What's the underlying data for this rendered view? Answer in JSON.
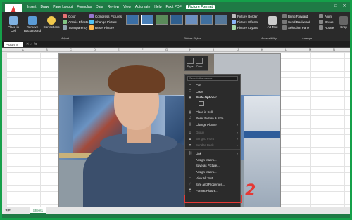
{
  "tabs": [
    "Insert",
    "Draw",
    "Page Layout",
    "Formulas",
    "Data",
    "Review",
    "View",
    "Automate",
    "Help",
    "Foxit PDF",
    "Picture Format"
  ],
  "active_tab": "Picture Format",
  "ribbon": {
    "place_in_cell": "Place in Cell",
    "remove_background": "Remove Background",
    "corrections": "Corrections",
    "color": "Color",
    "artistic_effects": "Artistic Effects",
    "transparency": "Transparency",
    "compress_pictures": "Compress Pictures",
    "change_picture": "Change Picture",
    "reset_picture": "Reset Picture",
    "adjust_label": "Adjust",
    "picture_styles_label": "Picture Styles",
    "picture_border": "Picture Border",
    "picture_effects": "Picture Effects",
    "picture_layout": "Picture Layout",
    "alt_text": "Alt Text",
    "accessibility_label": "Accessibility",
    "bring_forward": "Bring Forward",
    "send_backward": "Send Backward",
    "selection_pane": "Selection Pane",
    "arrange_label": "Arrange",
    "align": "Align",
    "group": "Group",
    "rotate": "Rotate",
    "crop": "Crop"
  },
  "name_box": "Picture 8",
  "columns": [
    "A",
    "B",
    "C",
    "D",
    "E",
    "F",
    "G",
    "H",
    "I",
    "J",
    "K",
    "L",
    "M",
    "N"
  ],
  "mini_toolbar": {
    "style": "Style",
    "crop": "Crop"
  },
  "context_menu": {
    "search_placeholder": "Search the menus",
    "items": [
      {
        "label": "Cut",
        "icon": "scissors-icon",
        "disabled": false,
        "submenu": false
      },
      {
        "label": "Copy",
        "icon": "copy-icon",
        "disabled": false,
        "submenu": false
      },
      {
        "label": "Paste Options:",
        "icon": "paste-icon",
        "disabled": false,
        "submenu": false,
        "bold": true
      },
      {
        "label": "",
        "icon": "",
        "disabled": false,
        "submenu": false,
        "paste_box": true
      },
      {
        "label": "Place in Cell",
        "icon": "place-in-cell-icon",
        "disabled": false,
        "submenu": false
      },
      {
        "label": "Reset Picture & Size",
        "icon": "reset-icon",
        "disabled": false,
        "submenu": false
      },
      {
        "label": "Change Picture",
        "icon": "change-picture-icon",
        "disabled": false,
        "submenu": true
      },
      {
        "label": "Group",
        "icon": "group-icon",
        "disabled": true,
        "submenu": true
      },
      {
        "label": "Bring to Front",
        "icon": "bring-front-icon",
        "disabled": true,
        "submenu": true
      },
      {
        "label": "Send to Back",
        "icon": "send-back-icon",
        "disabled": true,
        "submenu": true
      },
      {
        "label": "Link",
        "icon": "link-icon",
        "disabled": false,
        "submenu": true
      },
      {
        "label": "Assign Macro...",
        "icon": "",
        "disabled": false,
        "submenu": false
      },
      {
        "label": "Save as Picture...",
        "icon": "",
        "disabled": false,
        "submenu": false
      },
      {
        "label": "Assign Macro...",
        "icon": "",
        "disabled": false,
        "submenu": false
      },
      {
        "label": "View Alt Text...",
        "icon": "alt-text-icon",
        "disabled": false,
        "submenu": false
      },
      {
        "label": "Size and Properties...",
        "icon": "size-icon",
        "disabled": false,
        "submenu": false
      },
      {
        "label": "Format Picture...",
        "icon": "format-icon",
        "disabled": false,
        "submenu": false
      }
    ]
  },
  "annotation_number": "2",
  "sheet_tab": "Sheet1",
  "colors": {
    "excel_green": "#1f7a45",
    "highlight_red": "#e53935"
  }
}
